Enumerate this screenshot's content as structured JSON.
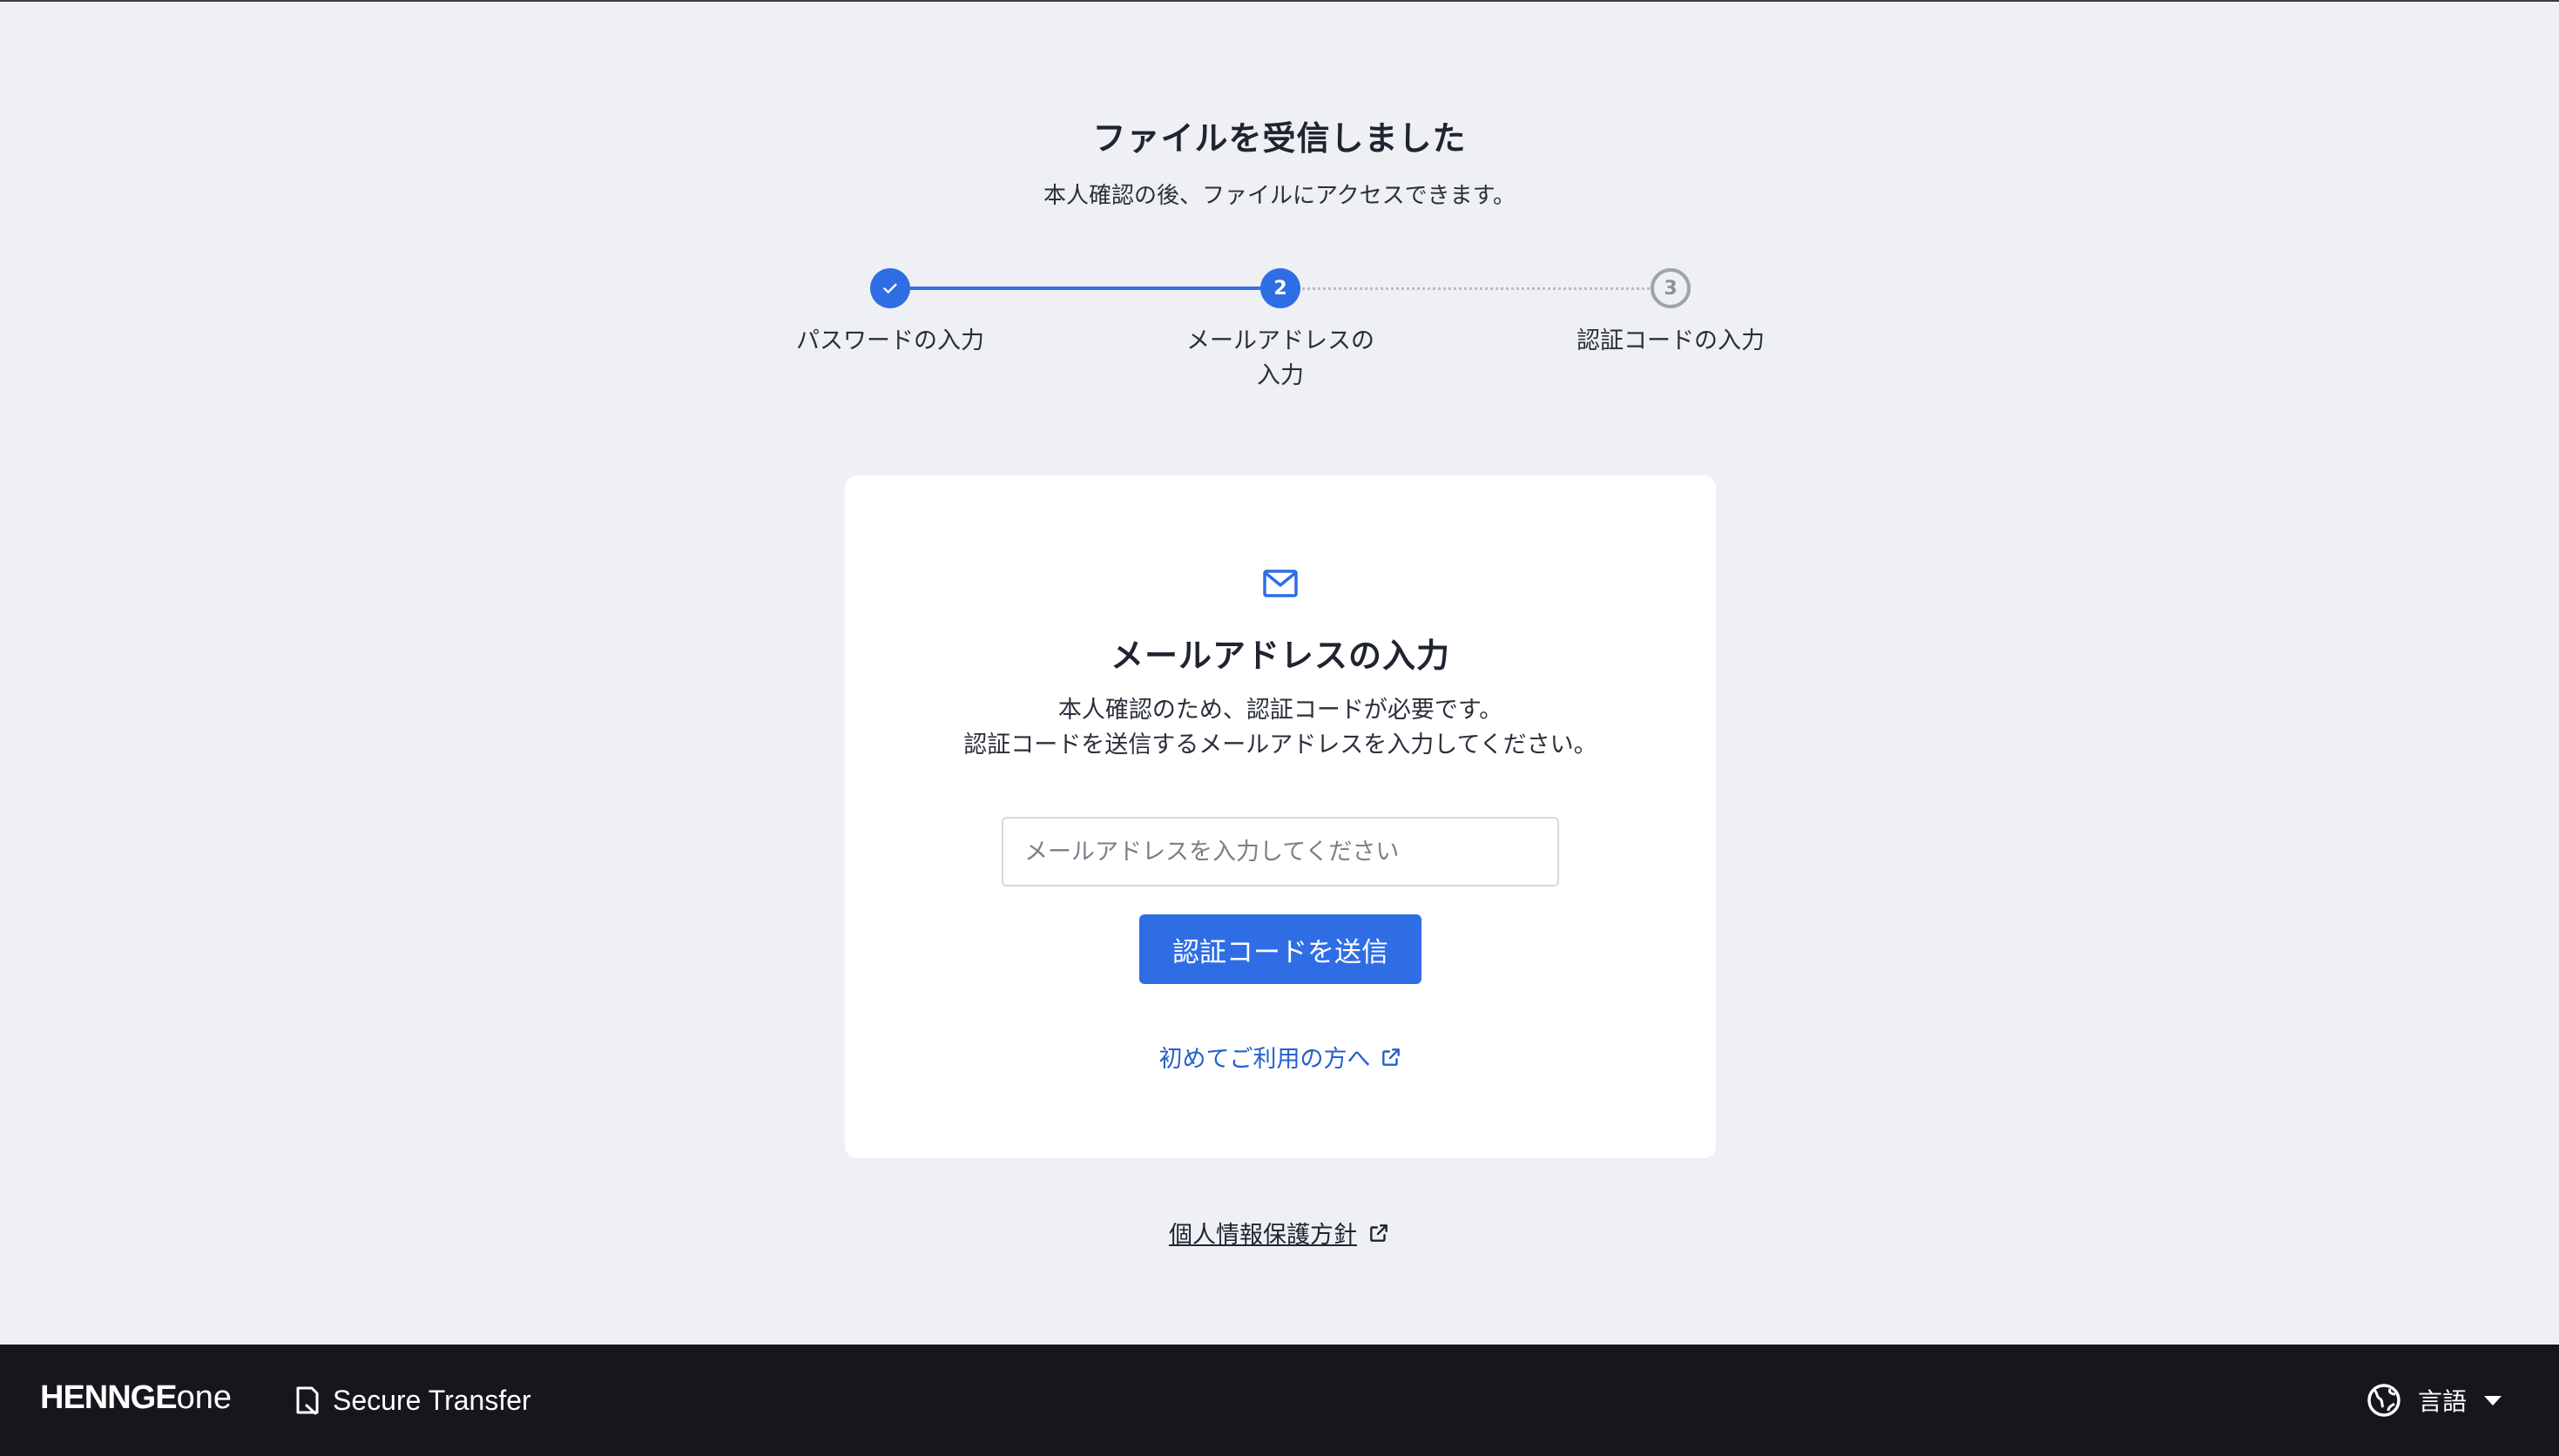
{
  "header": {
    "title": "ファイルを受信しました",
    "subtitle": "本人確認の後、ファイルにアクセスできます。"
  },
  "stepper": {
    "steps": [
      {
        "number": "",
        "label": "パスワードの入力",
        "state": "done"
      },
      {
        "number": "2",
        "label": "メールアドレスの入力",
        "state": "active"
      },
      {
        "number": "3",
        "label": "認証コードの入力",
        "state": "pending"
      }
    ]
  },
  "card": {
    "icon": "mail-icon",
    "title": "メールアドレスの入力",
    "desc_line1": "本人確認のため、認証コードが必要です。",
    "desc_line2": "認証コードを送信するメールアドレスを入力してください。",
    "email_value": "",
    "email_placeholder": "メールアドレスを入力してください",
    "send_label": "認証コードを送信",
    "first_time_link": "初めてご利用の方へ"
  },
  "privacy_link": "個人情報保護方針",
  "footer": {
    "brand_main": "HENNGE",
    "brand_sub": "one",
    "product": "Secure Transfer",
    "language": "言語"
  },
  "colors": {
    "accent": "#2f6de5",
    "link": "#2560cc",
    "footer_bg": "#15171c",
    "page_bg": "#eef0f4"
  }
}
